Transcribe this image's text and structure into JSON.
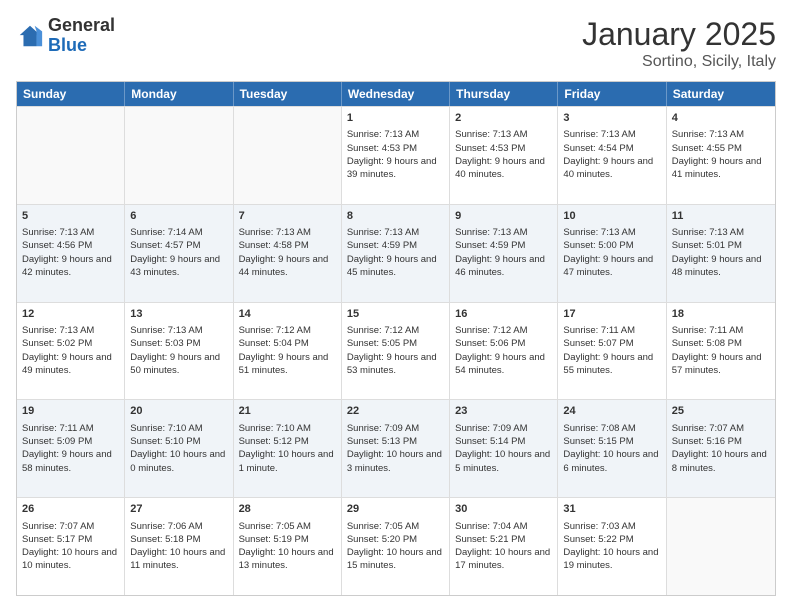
{
  "header": {
    "logo": {
      "general": "General",
      "blue": "Blue"
    },
    "title": "January 2025",
    "subtitle": "Sortino, Sicily, Italy"
  },
  "weekdays": [
    "Sunday",
    "Monday",
    "Tuesday",
    "Wednesday",
    "Thursday",
    "Friday",
    "Saturday"
  ],
  "rows": [
    {
      "alt": false,
      "cells": [
        {
          "day": "",
          "text": ""
        },
        {
          "day": "",
          "text": ""
        },
        {
          "day": "",
          "text": ""
        },
        {
          "day": "1",
          "text": "Sunrise: 7:13 AM\nSunset: 4:53 PM\nDaylight: 9 hours and 39 minutes."
        },
        {
          "day": "2",
          "text": "Sunrise: 7:13 AM\nSunset: 4:53 PM\nDaylight: 9 hours and 40 minutes."
        },
        {
          "day": "3",
          "text": "Sunrise: 7:13 AM\nSunset: 4:54 PM\nDaylight: 9 hours and 40 minutes."
        },
        {
          "day": "4",
          "text": "Sunrise: 7:13 AM\nSunset: 4:55 PM\nDaylight: 9 hours and 41 minutes."
        }
      ]
    },
    {
      "alt": true,
      "cells": [
        {
          "day": "5",
          "text": "Sunrise: 7:13 AM\nSunset: 4:56 PM\nDaylight: 9 hours and 42 minutes."
        },
        {
          "day": "6",
          "text": "Sunrise: 7:14 AM\nSunset: 4:57 PM\nDaylight: 9 hours and 43 minutes."
        },
        {
          "day": "7",
          "text": "Sunrise: 7:13 AM\nSunset: 4:58 PM\nDaylight: 9 hours and 44 minutes."
        },
        {
          "day": "8",
          "text": "Sunrise: 7:13 AM\nSunset: 4:59 PM\nDaylight: 9 hours and 45 minutes."
        },
        {
          "day": "9",
          "text": "Sunrise: 7:13 AM\nSunset: 4:59 PM\nDaylight: 9 hours and 46 minutes."
        },
        {
          "day": "10",
          "text": "Sunrise: 7:13 AM\nSunset: 5:00 PM\nDaylight: 9 hours and 47 minutes."
        },
        {
          "day": "11",
          "text": "Sunrise: 7:13 AM\nSunset: 5:01 PM\nDaylight: 9 hours and 48 minutes."
        }
      ]
    },
    {
      "alt": false,
      "cells": [
        {
          "day": "12",
          "text": "Sunrise: 7:13 AM\nSunset: 5:02 PM\nDaylight: 9 hours and 49 minutes."
        },
        {
          "day": "13",
          "text": "Sunrise: 7:13 AM\nSunset: 5:03 PM\nDaylight: 9 hours and 50 minutes."
        },
        {
          "day": "14",
          "text": "Sunrise: 7:12 AM\nSunset: 5:04 PM\nDaylight: 9 hours and 51 minutes."
        },
        {
          "day": "15",
          "text": "Sunrise: 7:12 AM\nSunset: 5:05 PM\nDaylight: 9 hours and 53 minutes."
        },
        {
          "day": "16",
          "text": "Sunrise: 7:12 AM\nSunset: 5:06 PM\nDaylight: 9 hours and 54 minutes."
        },
        {
          "day": "17",
          "text": "Sunrise: 7:11 AM\nSunset: 5:07 PM\nDaylight: 9 hours and 55 minutes."
        },
        {
          "day": "18",
          "text": "Sunrise: 7:11 AM\nSunset: 5:08 PM\nDaylight: 9 hours and 57 minutes."
        }
      ]
    },
    {
      "alt": true,
      "cells": [
        {
          "day": "19",
          "text": "Sunrise: 7:11 AM\nSunset: 5:09 PM\nDaylight: 9 hours and 58 minutes."
        },
        {
          "day": "20",
          "text": "Sunrise: 7:10 AM\nSunset: 5:10 PM\nDaylight: 10 hours and 0 minutes."
        },
        {
          "day": "21",
          "text": "Sunrise: 7:10 AM\nSunset: 5:12 PM\nDaylight: 10 hours and 1 minute."
        },
        {
          "day": "22",
          "text": "Sunrise: 7:09 AM\nSunset: 5:13 PM\nDaylight: 10 hours and 3 minutes."
        },
        {
          "day": "23",
          "text": "Sunrise: 7:09 AM\nSunset: 5:14 PM\nDaylight: 10 hours and 5 minutes."
        },
        {
          "day": "24",
          "text": "Sunrise: 7:08 AM\nSunset: 5:15 PM\nDaylight: 10 hours and 6 minutes."
        },
        {
          "day": "25",
          "text": "Sunrise: 7:07 AM\nSunset: 5:16 PM\nDaylight: 10 hours and 8 minutes."
        }
      ]
    },
    {
      "alt": false,
      "cells": [
        {
          "day": "26",
          "text": "Sunrise: 7:07 AM\nSunset: 5:17 PM\nDaylight: 10 hours and 10 minutes."
        },
        {
          "day": "27",
          "text": "Sunrise: 7:06 AM\nSunset: 5:18 PM\nDaylight: 10 hours and 11 minutes."
        },
        {
          "day": "28",
          "text": "Sunrise: 7:05 AM\nSunset: 5:19 PM\nDaylight: 10 hours and 13 minutes."
        },
        {
          "day": "29",
          "text": "Sunrise: 7:05 AM\nSunset: 5:20 PM\nDaylight: 10 hours and 15 minutes."
        },
        {
          "day": "30",
          "text": "Sunrise: 7:04 AM\nSunset: 5:21 PM\nDaylight: 10 hours and 17 minutes."
        },
        {
          "day": "31",
          "text": "Sunrise: 7:03 AM\nSunset: 5:22 PM\nDaylight: 10 hours and 19 minutes."
        },
        {
          "day": "",
          "text": ""
        }
      ]
    }
  ]
}
